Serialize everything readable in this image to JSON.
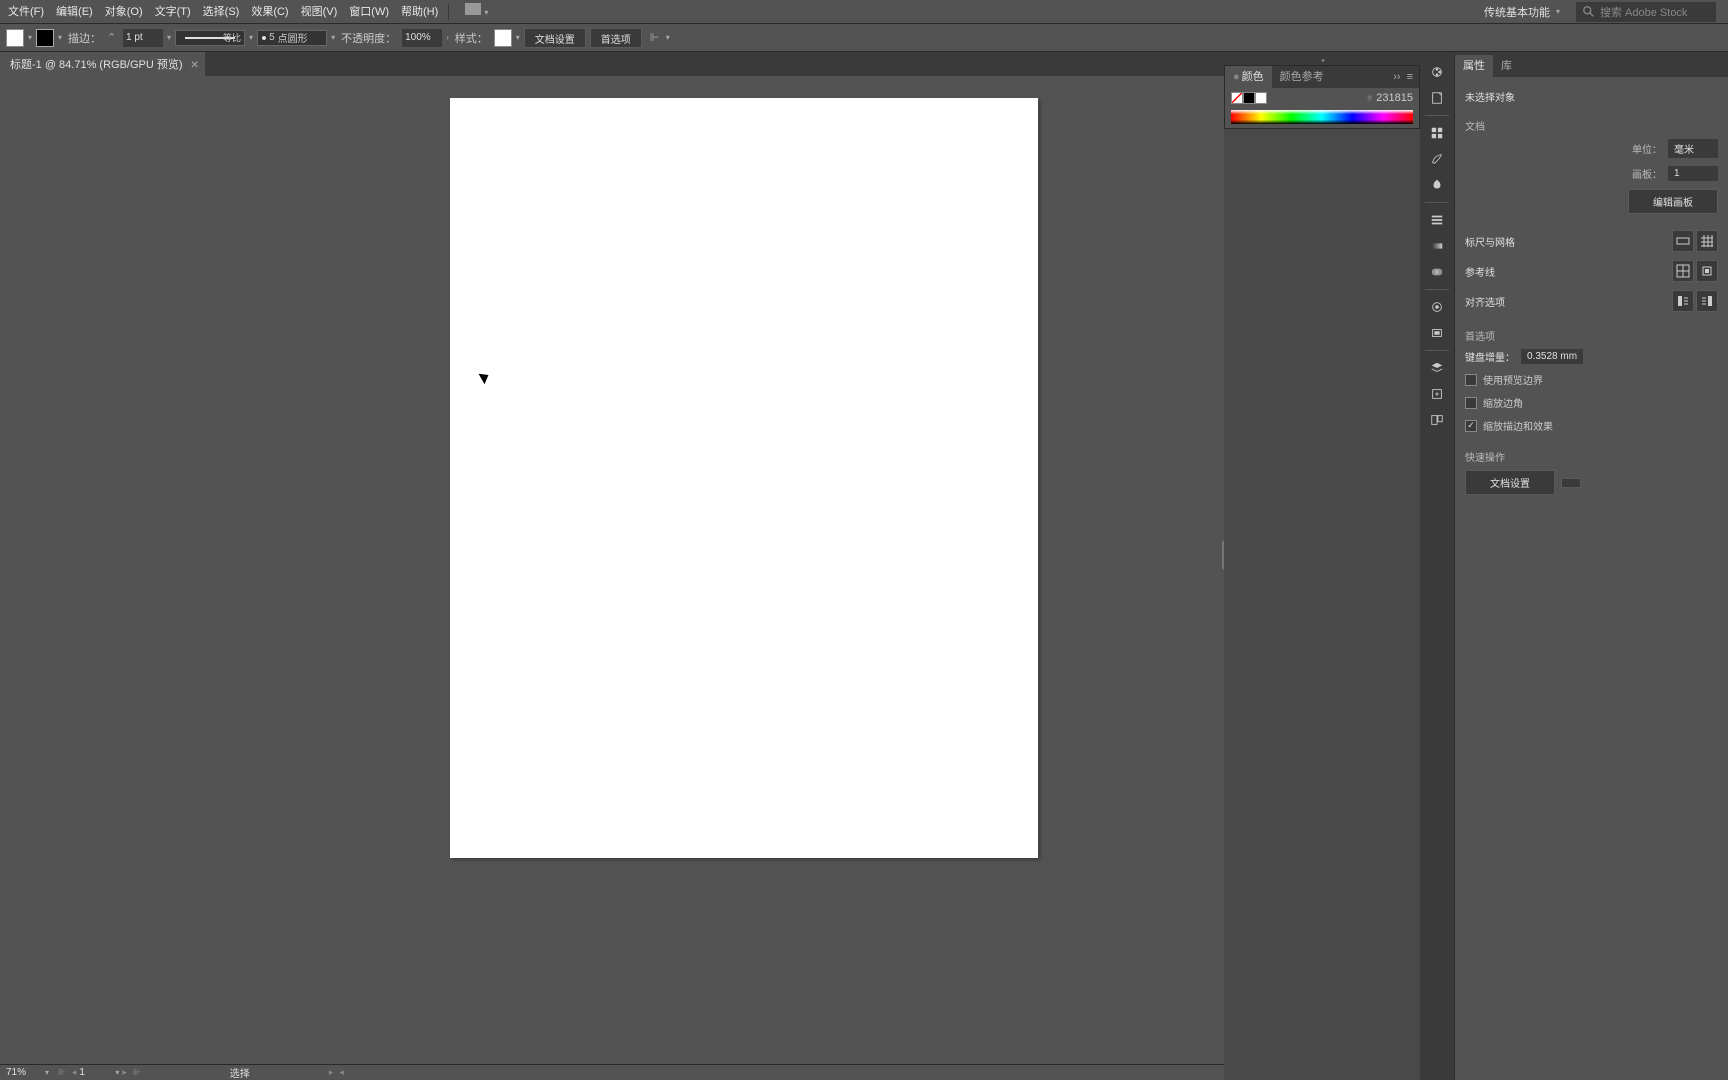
{
  "menubar": {
    "items": [
      "文件(F)",
      "编辑(E)",
      "对象(O)",
      "文字(T)",
      "选择(S)",
      "效果(C)",
      "视图(V)",
      "窗口(W)",
      "帮助(H)"
    ],
    "workspace": "传统基本功能",
    "search_placeholder": "搜索 Adobe Stock"
  },
  "options": {
    "stroke_label": "描边：",
    "stroke_weight": "1 pt",
    "stroke_style": "等比",
    "brush_size": "5",
    "brush_style": "点圆形",
    "opacity_label": "不透明度：",
    "opacity_value": "100%",
    "style_label": "样式：",
    "doc_setup": "文档设置",
    "prefs": "首选项"
  },
  "tab": {
    "title": "标题-1 @ 84.71% (RGB/GPU 预览)"
  },
  "status": {
    "zoom": "71%",
    "artboard_num": "1",
    "tool": "选择"
  },
  "color_panel": {
    "tab_color": "颜色",
    "tab_guide": "颜色参考",
    "hex": "231815"
  },
  "props": {
    "tab_props": "属性",
    "tab_lib": "库",
    "no_selection": "未选择对象",
    "doc_heading": "文档",
    "unit_label": "单位：",
    "unit_value": "毫米",
    "artboard_label": "画板：",
    "artboard_value": "1",
    "edit_artboard": "编辑画板",
    "ruler_grid": "标尺与网格",
    "guides": "参考线",
    "align": "对齐选项",
    "prefs_heading": "首选项",
    "key_inc_label": "键盘增量：",
    "key_inc_value": "0.3528 mm",
    "cb_preview": "使用预览边界",
    "cb_scale_corner": "缩放边角",
    "cb_scale_stroke": "缩放描边和效果",
    "quick_actions": "快速操作",
    "doc_setup_btn": "文档设置"
  }
}
